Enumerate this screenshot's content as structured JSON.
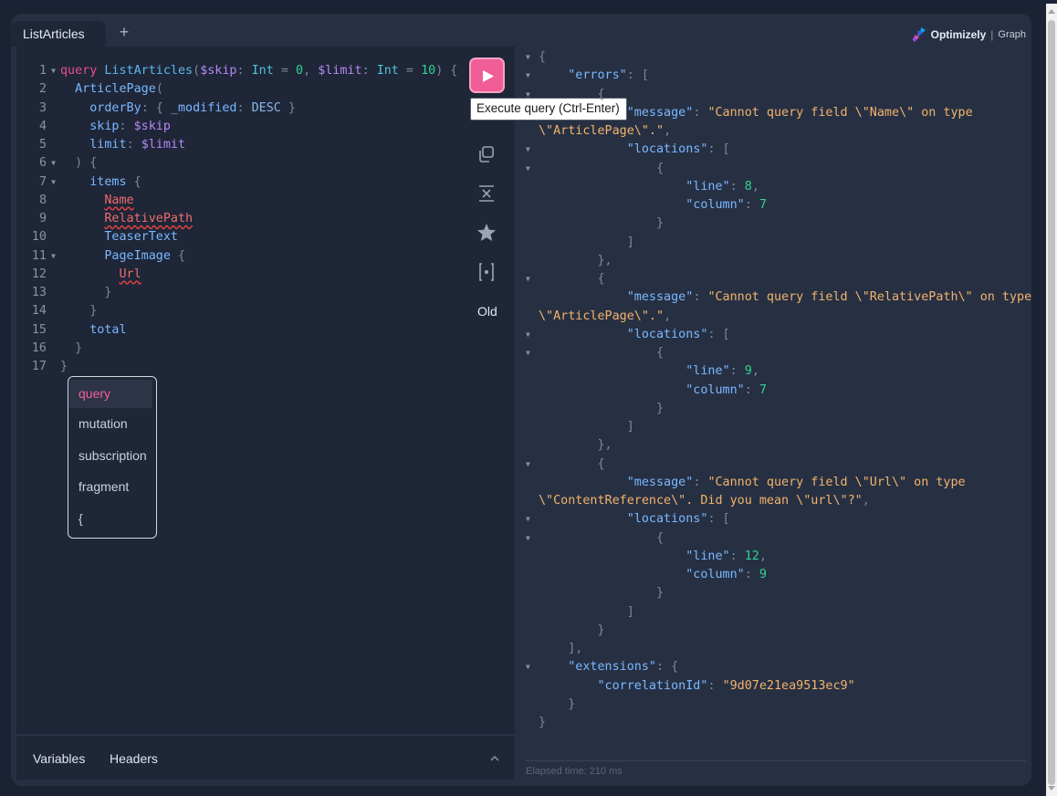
{
  "tabs": {
    "active_label": "ListArticles",
    "add_label": "+"
  },
  "brand": {
    "name": "Optimizely",
    "separator": "|",
    "product": "Graph"
  },
  "toolbar": {
    "execute_tooltip": "Execute query (Ctrl-Enter)",
    "old_label": "Old",
    "icons": [
      "play-icon",
      "prettify-icon",
      "copy-icon",
      "merge-icon",
      "star-icon",
      "variables-braces-icon"
    ]
  },
  "editor": {
    "lines": [
      [
        [
          "kw",
          "query"
        ],
        [
          "p",
          " "
        ],
        [
          "fn",
          "ListArticles"
        ],
        [
          "punc",
          "("
        ],
        [
          "var",
          "$skip"
        ],
        [
          "punc",
          ": "
        ],
        [
          "tp",
          "Int"
        ],
        [
          "punc",
          " = "
        ],
        [
          "num",
          "0"
        ],
        [
          "punc",
          ", "
        ],
        [
          "var",
          "$limit"
        ],
        [
          "punc",
          ": "
        ],
        [
          "tp",
          "Int"
        ],
        [
          "punc",
          " = "
        ],
        [
          "num",
          "10"
        ],
        [
          "punc",
          ") {"
        ]
      ],
      [
        [
          "p",
          "  "
        ],
        [
          "fld",
          "ArticlePage"
        ],
        [
          "punc",
          "("
        ]
      ],
      [
        [
          "p",
          "    "
        ],
        [
          "fld",
          "orderBy"
        ],
        [
          "punc",
          ": { "
        ],
        [
          "fld",
          "_modified"
        ],
        [
          "punc",
          ": "
        ],
        [
          "enm",
          "DESC"
        ],
        [
          "punc",
          " }"
        ]
      ],
      [
        [
          "p",
          "    "
        ],
        [
          "fld",
          "skip"
        ],
        [
          "punc",
          ": "
        ],
        [
          "var",
          "$skip"
        ]
      ],
      [
        [
          "p",
          "    "
        ],
        [
          "fld",
          "limit"
        ],
        [
          "punc",
          ": "
        ],
        [
          "var",
          "$limit"
        ]
      ],
      [
        [
          "p",
          "  "
        ],
        [
          "punc",
          ") {"
        ]
      ],
      [
        [
          "p",
          "    "
        ],
        [
          "fld",
          "items"
        ],
        [
          "punc",
          " {"
        ]
      ],
      [
        [
          "p",
          "      "
        ],
        [
          "err",
          "Name"
        ]
      ],
      [
        [
          "p",
          "      "
        ],
        [
          "err",
          "RelativePath"
        ]
      ],
      [
        [
          "p",
          "      "
        ],
        [
          "fld",
          "TeaserText"
        ]
      ],
      [
        [
          "p",
          "      "
        ],
        [
          "fld",
          "PageImage"
        ],
        [
          "punc",
          " {"
        ]
      ],
      [
        [
          "p",
          "        "
        ],
        [
          "err",
          "Url"
        ]
      ],
      [
        [
          "p",
          "      "
        ],
        [
          "punc",
          "}"
        ]
      ],
      [
        [
          "p",
          "    "
        ],
        [
          "punc",
          "}"
        ]
      ],
      [
        [
          "p",
          "    "
        ],
        [
          "fld",
          "total"
        ]
      ],
      [
        [
          "p",
          "  "
        ],
        [
          "punc",
          "}"
        ]
      ],
      [
        [
          "punc",
          "}"
        ]
      ]
    ],
    "line_numbers": [
      "1",
      "2",
      "3",
      "4",
      "5",
      "6",
      "7",
      "8",
      "9",
      "10",
      "11",
      "12",
      "13",
      "14",
      "15",
      "16",
      "17"
    ],
    "foldable": [
      1,
      6,
      7,
      11
    ]
  },
  "autocomplete": {
    "items": [
      "query",
      "mutation",
      "subscription",
      "fragment",
      "{"
    ],
    "selected_index": 0
  },
  "bottom": {
    "variables_label": "Variables",
    "headers_label": "Headers"
  },
  "result": {
    "lines": [
      {
        "fold": true,
        "indent": 0,
        "parts": [
          [
            "punc",
            "{"
          ]
        ]
      },
      {
        "fold": true,
        "indent": 1,
        "parts": [
          [
            "key",
            "\"errors\""
          ],
          [
            "punc",
            ": ["
          ]
        ]
      },
      {
        "fold": true,
        "indent": 2,
        "parts": [
          [
            "punc",
            "{"
          ]
        ]
      },
      {
        "fold": false,
        "indent": 3,
        "parts": [
          [
            "key",
            "\"message\""
          ],
          [
            "punc",
            ": "
          ],
          [
            "str",
            "\"Cannot query field \\\"Name\\\" on type"
          ]
        ]
      },
      {
        "fold": false,
        "indent": 0,
        "parts": [
          [
            "str",
            "\\\"ArticlePage\\\".\""
          ],
          [
            "punc",
            ","
          ]
        ]
      },
      {
        "fold": true,
        "indent": 3,
        "parts": [
          [
            "key",
            "\"locations\""
          ],
          [
            "punc",
            ": ["
          ]
        ]
      },
      {
        "fold": true,
        "indent": 4,
        "parts": [
          [
            "punc",
            "{"
          ]
        ]
      },
      {
        "fold": false,
        "indent": 5,
        "parts": [
          [
            "key",
            "\"line\""
          ],
          [
            "punc",
            ": "
          ],
          [
            "num",
            "8"
          ],
          [
            "punc",
            ","
          ]
        ]
      },
      {
        "fold": false,
        "indent": 5,
        "parts": [
          [
            "key",
            "\"column\""
          ],
          [
            "punc",
            ": "
          ],
          [
            "num",
            "7"
          ]
        ]
      },
      {
        "fold": false,
        "indent": 4,
        "parts": [
          [
            "punc",
            "}"
          ]
        ]
      },
      {
        "fold": false,
        "indent": 3,
        "parts": [
          [
            "punc",
            "]"
          ]
        ]
      },
      {
        "fold": false,
        "indent": 2,
        "parts": [
          [
            "punc",
            "},"
          ]
        ]
      },
      {
        "fold": true,
        "indent": 2,
        "parts": [
          [
            "punc",
            "{"
          ]
        ]
      },
      {
        "fold": false,
        "indent": 3,
        "parts": [
          [
            "key",
            "\"message\""
          ],
          [
            "punc",
            ": "
          ],
          [
            "str",
            "\"Cannot query field \\\"RelativePath\\\" on type"
          ]
        ]
      },
      {
        "fold": false,
        "indent": 0,
        "parts": [
          [
            "str",
            "\\\"ArticlePage\\\".\""
          ],
          [
            "punc",
            ","
          ]
        ]
      },
      {
        "fold": true,
        "indent": 3,
        "parts": [
          [
            "key",
            "\"locations\""
          ],
          [
            "punc",
            ": ["
          ]
        ]
      },
      {
        "fold": true,
        "indent": 4,
        "parts": [
          [
            "punc",
            "{"
          ]
        ]
      },
      {
        "fold": false,
        "indent": 5,
        "parts": [
          [
            "key",
            "\"line\""
          ],
          [
            "punc",
            ": "
          ],
          [
            "num",
            "9"
          ],
          [
            "punc",
            ","
          ]
        ]
      },
      {
        "fold": false,
        "indent": 5,
        "parts": [
          [
            "key",
            "\"column\""
          ],
          [
            "punc",
            ": "
          ],
          [
            "num",
            "7"
          ]
        ]
      },
      {
        "fold": false,
        "indent": 4,
        "parts": [
          [
            "punc",
            "}"
          ]
        ]
      },
      {
        "fold": false,
        "indent": 3,
        "parts": [
          [
            "punc",
            "]"
          ]
        ]
      },
      {
        "fold": false,
        "indent": 2,
        "parts": [
          [
            "punc",
            "},"
          ]
        ]
      },
      {
        "fold": true,
        "indent": 2,
        "parts": [
          [
            "punc",
            "{"
          ]
        ]
      },
      {
        "fold": false,
        "indent": 3,
        "parts": [
          [
            "key",
            "\"message\""
          ],
          [
            "punc",
            ": "
          ],
          [
            "str",
            "\"Cannot query field \\\"Url\\\" on type"
          ]
        ]
      },
      {
        "fold": false,
        "indent": 0,
        "parts": [
          [
            "str",
            "\\\"ContentReference\\\". Did you mean \\\"url\\\"?\""
          ],
          [
            "punc",
            ","
          ]
        ]
      },
      {
        "fold": true,
        "indent": 3,
        "parts": [
          [
            "key",
            "\"locations\""
          ],
          [
            "punc",
            ": ["
          ]
        ]
      },
      {
        "fold": true,
        "indent": 4,
        "parts": [
          [
            "punc",
            "{"
          ]
        ]
      },
      {
        "fold": false,
        "indent": 5,
        "parts": [
          [
            "key",
            "\"line\""
          ],
          [
            "punc",
            ": "
          ],
          [
            "num",
            "12"
          ],
          [
            "punc",
            ","
          ]
        ]
      },
      {
        "fold": false,
        "indent": 5,
        "parts": [
          [
            "key",
            "\"column\""
          ],
          [
            "punc",
            ": "
          ],
          [
            "num",
            "9"
          ]
        ]
      },
      {
        "fold": false,
        "indent": 4,
        "parts": [
          [
            "punc",
            "}"
          ]
        ]
      },
      {
        "fold": false,
        "indent": 3,
        "parts": [
          [
            "punc",
            "]"
          ]
        ]
      },
      {
        "fold": false,
        "indent": 2,
        "parts": [
          [
            "punc",
            "}"
          ]
        ]
      },
      {
        "fold": false,
        "indent": 1,
        "parts": [
          [
            "punc",
            "],"
          ]
        ]
      },
      {
        "fold": true,
        "indent": 1,
        "parts": [
          [
            "key",
            "\"extensions\""
          ],
          [
            "punc",
            ": {"
          ]
        ]
      },
      {
        "fold": false,
        "indent": 2,
        "parts": [
          [
            "key",
            "\"correlationId\""
          ],
          [
            "punc",
            ": "
          ],
          [
            "str",
            "\"9d07e21ea9513ec9\""
          ]
        ]
      },
      {
        "fold": false,
        "indent": 1,
        "parts": [
          [
            "punc",
            "}"
          ]
        ]
      },
      {
        "fold": false,
        "indent": 0,
        "parts": [
          [
            "punc",
            "}"
          ]
        ]
      }
    ]
  },
  "status": {
    "elapsed": "Elapsed time: 210 ms"
  },
  "colors": {
    "accent": "#f05d97",
    "panel": "#273043",
    "editor": "#1e2638"
  }
}
